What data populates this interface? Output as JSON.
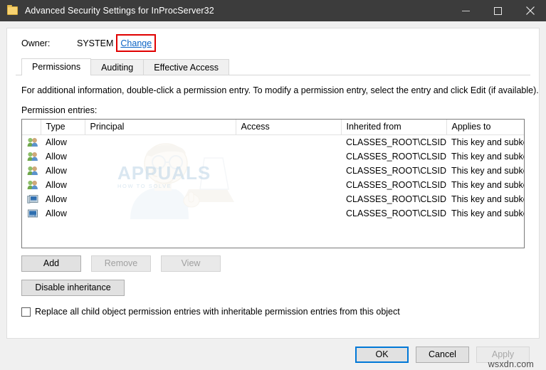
{
  "window": {
    "title": "Advanced Security Settings for InProcServer32",
    "icon": "folder-icon",
    "controls": {
      "minimize": "minimize-icon",
      "maximize": "maximize-icon",
      "close": "close-icon"
    }
  },
  "owner": {
    "label": "Owner:",
    "value": "SYSTEM",
    "change_link": "Change",
    "highlight_color": "#e00000"
  },
  "tabs": [
    {
      "label": "Permissions",
      "selected": true
    },
    {
      "label": "Auditing",
      "selected": false
    },
    {
      "label": "Effective Access",
      "selected": false
    }
  ],
  "info_text": "For additional information, double-click a permission entry. To modify a permission entry, select the entry and click Edit (if available).",
  "entries_label": "Permission entries:",
  "table": {
    "columns": [
      "",
      "Type",
      "Principal",
      "Access",
      "Inherited from",
      "Applies to"
    ],
    "rows": [
      {
        "icon": "users-group-icon",
        "type": "Allow",
        "principal": "",
        "access": "",
        "inherited_from": "CLASSES_ROOT\\CLSID...",
        "applies_to": "This key and subkeys"
      },
      {
        "icon": "users-group-icon",
        "type": "Allow",
        "principal": "",
        "access": "",
        "inherited_from": "CLASSES_ROOT\\CLSID...",
        "applies_to": "This key and subkeys"
      },
      {
        "icon": "users-group-icon",
        "type": "Allow",
        "principal": "",
        "access": "",
        "inherited_from": "CLASSES_ROOT\\CLSID...",
        "applies_to": "This key and subkeys"
      },
      {
        "icon": "users-group-icon",
        "type": "Allow",
        "principal": "",
        "access": "",
        "inherited_from": "CLASSES_ROOT\\CLSID...",
        "applies_to": "This key and subkeys"
      },
      {
        "icon": "computer-icon",
        "type": "Allow",
        "principal": "",
        "access": "",
        "inherited_from": "CLASSES_ROOT\\CLSID...",
        "applies_to": "This key and subkeys"
      },
      {
        "icon": "monitor-icon",
        "type": "Allow",
        "principal": "",
        "access": "",
        "inherited_from": "CLASSES_ROOT\\CLSID...",
        "applies_to": "This key and subkeys"
      }
    ]
  },
  "entry_buttons": [
    {
      "label": "Add",
      "enabled": true
    },
    {
      "label": "Remove",
      "enabled": false
    },
    {
      "label": "View",
      "enabled": false
    }
  ],
  "inheritance_button": {
    "label": "Disable inheritance",
    "enabled": true
  },
  "replace_checkbox": {
    "label": "Replace all child object permission entries with inheritable permission entries from this object",
    "checked": false
  },
  "footer_buttons": [
    {
      "label": "OK",
      "enabled": true,
      "default": true
    },
    {
      "label": "Cancel",
      "enabled": true,
      "default": false
    },
    {
      "label": "Apply",
      "enabled": false,
      "default": false
    }
  ],
  "watermarks": {
    "brand": "APPUALS",
    "brand_sub": "HOW TO SOLVE",
    "site": "wsxdn.com"
  }
}
